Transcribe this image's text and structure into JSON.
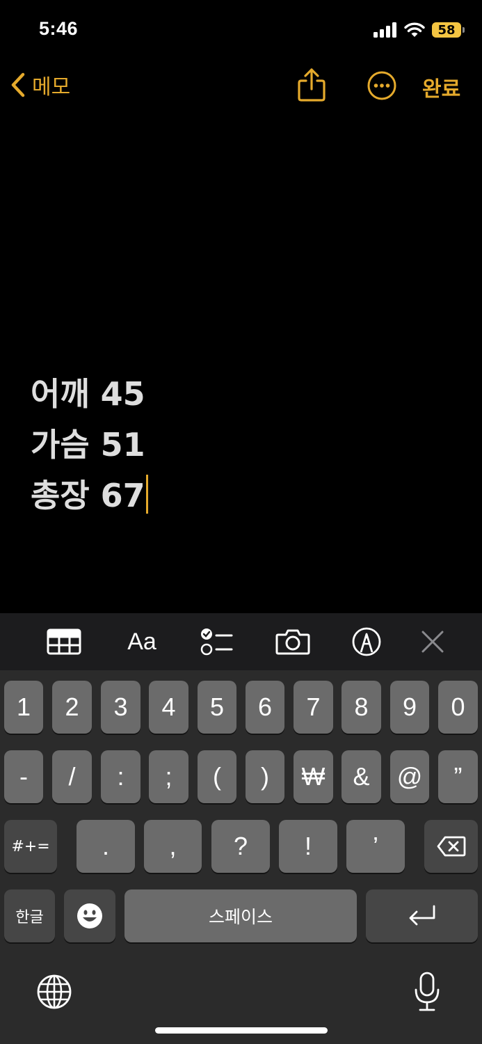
{
  "status_bar": {
    "time": "5:46",
    "battery_level": "58",
    "icons": [
      "cellular-signal-icon",
      "wifi-icon",
      "battery-icon"
    ]
  },
  "nav": {
    "back_label": "메모",
    "done_label": "완료",
    "icons": [
      "chevron-left-icon",
      "share-icon",
      "more-icon"
    ]
  },
  "note": {
    "lines": [
      "어깨 45",
      "가슴 51",
      "총장 67"
    ]
  },
  "toolbar": {
    "format_label": "Aa",
    "icons": [
      "table-icon",
      "format-icon",
      "checklist-icon",
      "camera-icon",
      "markup-icon",
      "close-icon"
    ]
  },
  "keyboard": {
    "row1": [
      "1",
      "2",
      "3",
      "4",
      "5",
      "6",
      "7",
      "8",
      "9",
      "0"
    ],
    "row2": [
      "-",
      "/",
      ":",
      ";",
      "(",
      ")",
      "₩",
      "&",
      "@",
      "”"
    ],
    "row3": {
      "symbols_label": "#+=",
      "keys": [
        ".",
        ",",
        "?",
        "!",
        "’"
      ]
    },
    "row4": {
      "lang_label": "한글",
      "space_label": "스페이스"
    }
  },
  "accent_color": "#e5aa2c"
}
